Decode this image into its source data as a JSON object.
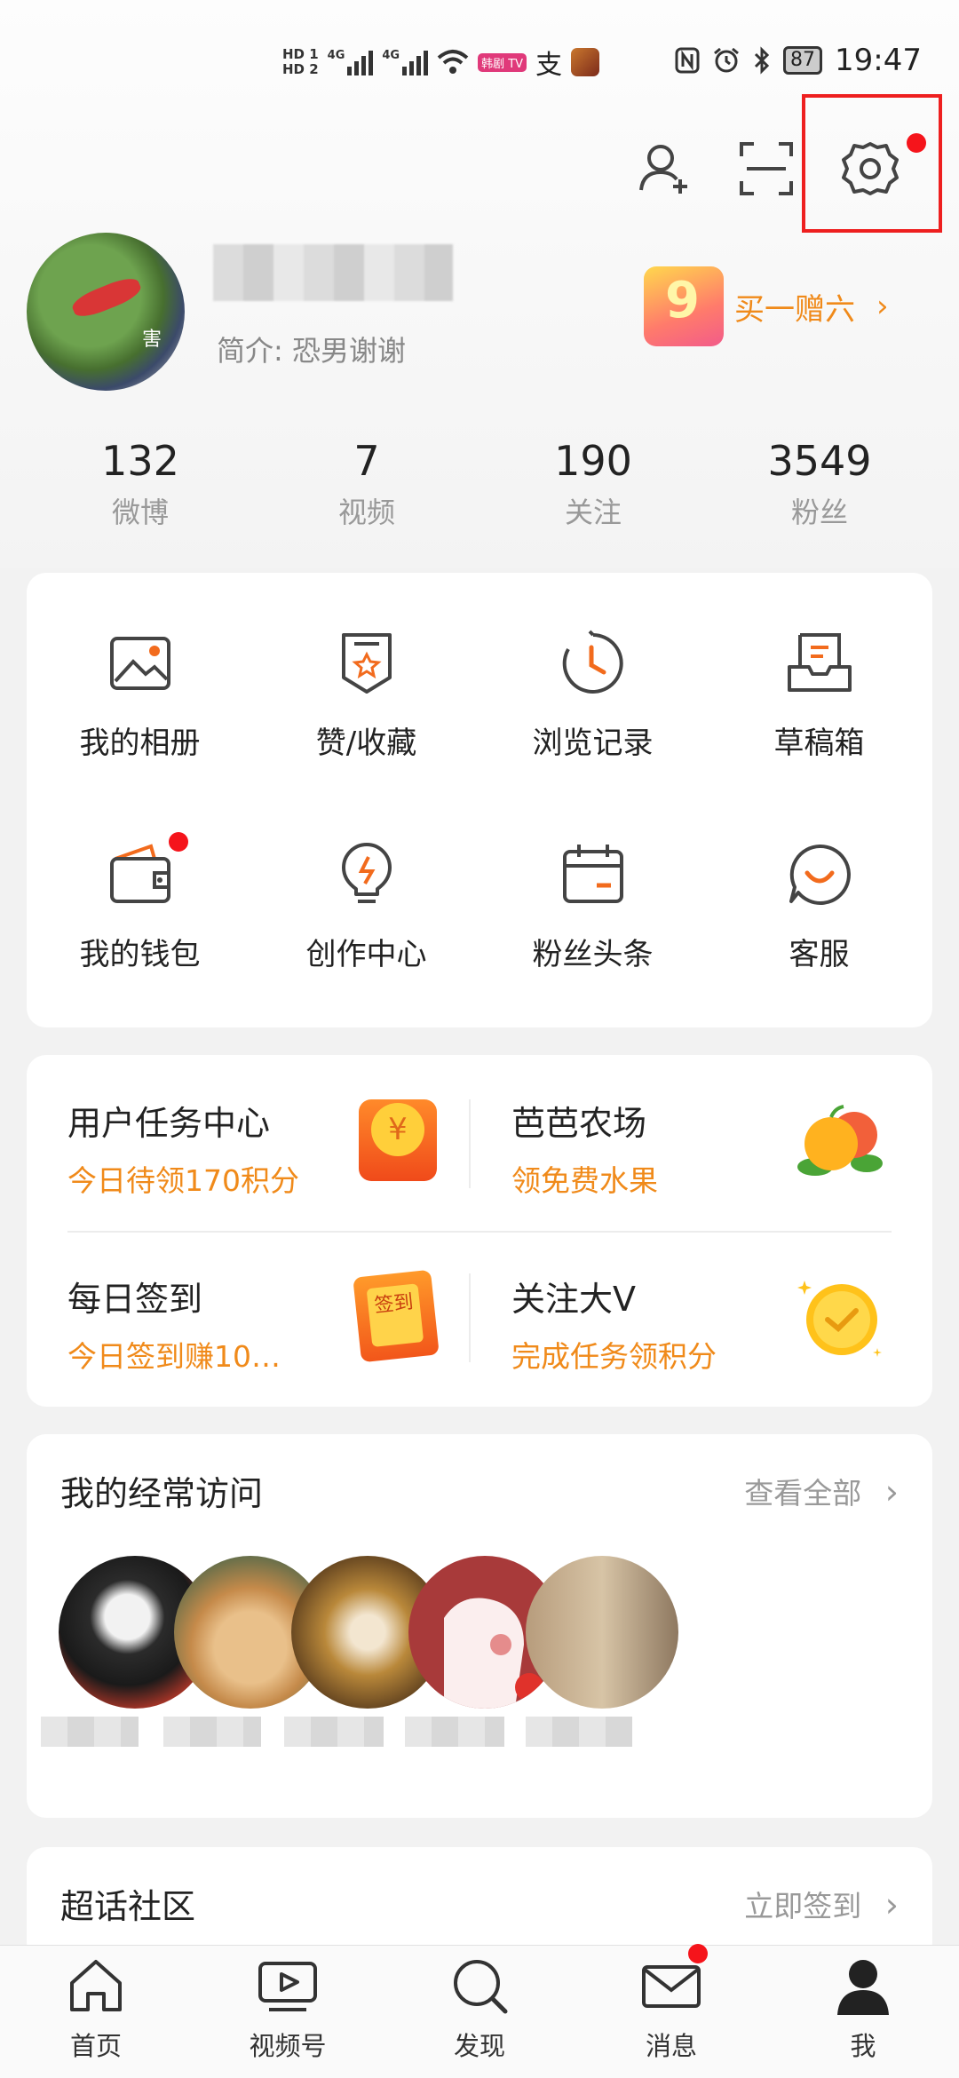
{
  "status_bar": {
    "hd1": "HD 1",
    "hd2": "HD 2",
    "net1": "4G",
    "net2": "4G",
    "tv_badge": "韩剧 TV",
    "pay_glyph": "支",
    "battery": "87",
    "time": "19:47"
  },
  "profile": {
    "bio": "简介: 恐男谢谢",
    "avatar_tag": "害",
    "promo_label": "买一赠六",
    "promo_badge": "9"
  },
  "stats": [
    {
      "value": "132",
      "label": "微博"
    },
    {
      "value": "7",
      "label": "视频"
    },
    {
      "value": "190",
      "label": "关注"
    },
    {
      "value": "3549",
      "label": "粉丝"
    }
  ],
  "tools": [
    {
      "label": "我的相册",
      "icon": "photo-album-icon"
    },
    {
      "label": "赞/收藏",
      "icon": "favorites-icon"
    },
    {
      "label": "浏览记录",
      "icon": "history-clock-icon"
    },
    {
      "label": "草稿箱",
      "icon": "draft-box-icon"
    },
    {
      "label": "我的钱包",
      "icon": "wallet-icon"
    },
    {
      "label": "创作中心",
      "icon": "creator-bulb-icon"
    },
    {
      "label": "粉丝头条",
      "icon": "calendar-icon"
    },
    {
      "label": "客服",
      "icon": "customer-service-icon"
    }
  ],
  "tasks": [
    {
      "title": "用户任务中心",
      "subtitle": "今日待领170积分",
      "icon": "coin-pouch-icon"
    },
    {
      "title": "芭芭农场",
      "subtitle": "领免费水果",
      "icon": "fruit-icon"
    },
    {
      "title": "每日签到",
      "subtitle": "今日签到赚10…",
      "icon": "checkin-card-icon"
    },
    {
      "title": "关注大V",
      "subtitle": "完成任务领积分",
      "icon": "check-coin-icon"
    }
  ],
  "task_icon_text": {
    "coin": "¥",
    "checkin": "签到"
  },
  "frequent": {
    "title": "我的经常访问",
    "link": "查看全部"
  },
  "super_topic": {
    "title": "超话社区",
    "link": "立即签到"
  },
  "chevron": "›",
  "nav": [
    {
      "label": "首页",
      "icon": "home-icon"
    },
    {
      "label": "视频号",
      "icon": "video-icon"
    },
    {
      "label": "发现",
      "icon": "search-icon"
    },
    {
      "label": "消息",
      "icon": "mail-icon"
    },
    {
      "label": "我",
      "icon": "profile-icon"
    }
  ],
  "colors": {
    "accent": "#f08a1a",
    "badge_red": "#f5141b",
    "highlight_box": "#ee1f1f"
  }
}
